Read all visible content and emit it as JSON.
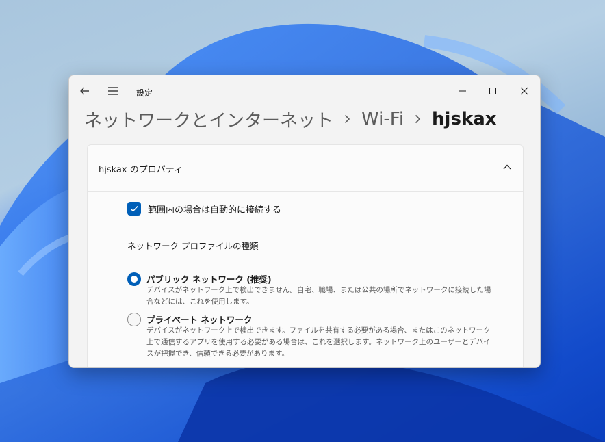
{
  "window": {
    "app_title": "設定",
    "breadcrumb": [
      "ネットワークとインターネット",
      "Wi-Fi",
      "hjskax"
    ]
  },
  "properties": {
    "title": "hjskax のプロパティ",
    "auto_connect": {
      "label": "範囲内の場合は自動的に接続する",
      "checked": true
    },
    "profile_type": {
      "heading": "ネットワーク プロファイルの種類",
      "options": [
        {
          "title": "パブリック ネットワーク (推奨)",
          "description": "デバイスがネットワーク上で検出できません。自宅、職場、または公共の場所でネットワークに接続した場合などには、これを使用します。",
          "selected": true
        },
        {
          "title": "プライベート ネットワーク",
          "description": "デバイスがネットワーク上で検出できます。ファイルを共有する必要がある場合、またはこのネットワーク上で通信するアプリを使用する必要がある場合は、これを選択します。ネットワーク上のユーザーとデバイスが把握でき、信頼できる必要があります。",
          "selected": false
        }
      ]
    }
  },
  "icons": {
    "back": "back-arrow-icon",
    "menu": "hamburger-menu-icon",
    "minimize": "minimize-icon",
    "maximize": "maximize-icon",
    "close": "close-icon",
    "separator": "chevron-right-icon",
    "collapse": "chevron-up-icon",
    "check": "checkmark-icon"
  },
  "colors": {
    "accent": "#005fb8",
    "window_bg": "#f3f3f3"
  }
}
